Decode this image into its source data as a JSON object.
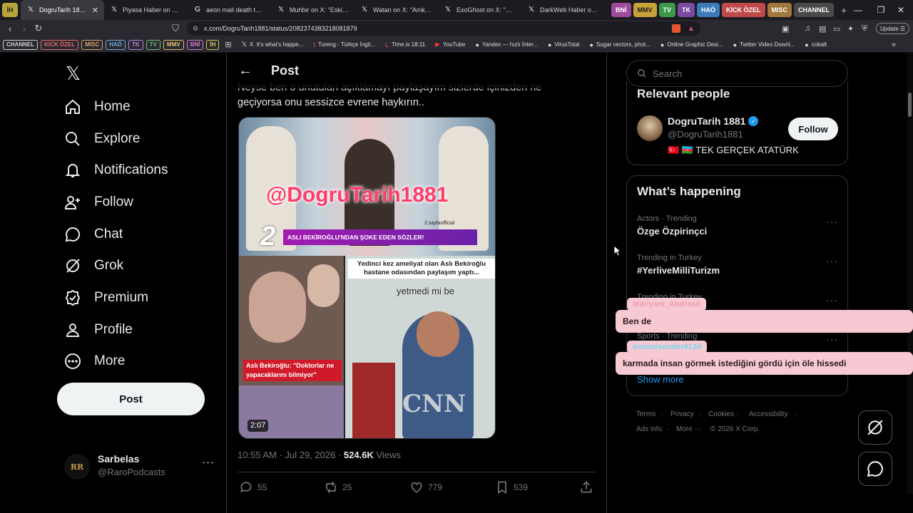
{
  "browser": {
    "pinned_left": [
      {
        "label": "İH",
        "color": "#b8a53a"
      }
    ],
    "tabs": [
      {
        "title": "DogruTarih 1881 on X",
        "active": true
      },
      {
        "title": "Piyasa Haber on X: \"Jap..."
      },
      {
        "title": "aeon mall death toll - G"
      },
      {
        "title": "Muhbir on X: \"Eski g..."
      },
      {
        "title": "Watan on X: \"Amk bu ü..."
      },
      {
        "title": "ExoGhost on X: \"The m..."
      },
      {
        "title": "DarkWeb Haber on X: \"..."
      }
    ],
    "groups": [
      {
        "label": "BNİ",
        "color": "#a04a9b"
      },
      {
        "label": "MMV",
        "color": "#c8a23a"
      },
      {
        "label": "TV",
        "color": "#3c9a4a"
      },
      {
        "label": "TK",
        "color": "#7a4aa0"
      },
      {
        "label": "HAÖ",
        "color": "#3a7ab8"
      },
      {
        "label": "KİCK ÖZEL",
        "color": "#c04a4a"
      },
      {
        "label": "MISC",
        "color": "#a0783a"
      },
      {
        "label": "CHANNEL",
        "color": "#4a4a4a"
      }
    ],
    "url": "x.com/DogruTarih1881/status/2082374383218081879",
    "update_label": "Update",
    "bookmark_pills": [
      {
        "label": "CHANNEL",
        "color": "#cfcfcf"
      },
      {
        "label": "KİCK ÖZEL",
        "color": "#e06a6a"
      },
      {
        "label": "MISC",
        "color": "#d8a66a"
      },
      {
        "label": "HAÖ",
        "color": "#6aaee0"
      },
      {
        "label": "TK",
        "color": "#b68ae0"
      },
      {
        "label": "TV",
        "color": "#6ac07a"
      },
      {
        "label": "MMV",
        "color": "#e0c06a"
      },
      {
        "label": "BNİ",
        "color": "#d87ad0"
      },
      {
        "label": "İH",
        "color": "#d8c85a"
      }
    ],
    "bookmarks": [
      {
        "icon": "𝕏",
        "label": "X. It's what's happe..."
      },
      {
        "icon": "t",
        "label": "Tureng - Türkçe İngil..."
      },
      {
        "icon": "L",
        "label": "Time.is 18:11"
      },
      {
        "icon": "▶",
        "label": "YouTube"
      },
      {
        "icon": "●",
        "label": "Yandex — hızlı İnter..."
      },
      {
        "icon": "●",
        "label": "VirusTotal"
      },
      {
        "icon": "●",
        "label": "Sugar vectors, phot..."
      },
      {
        "icon": "●",
        "label": "Online Graphic Desi..."
      },
      {
        "icon": "●",
        "label": "Twitter Video Downl..."
      },
      {
        "icon": "●",
        "label": "cobalt"
      }
    ]
  },
  "nav": {
    "items": [
      "Home",
      "Explore",
      "Notifications",
      "Follow",
      "Chat",
      "Grok",
      "Premium",
      "Profile",
      "More"
    ],
    "post_label": "Post",
    "account": {
      "name": "Sarbelas",
      "handle": "@RaroPodcasts"
    }
  },
  "post": {
    "header": "Post",
    "text_line1": "Neyse ben o unutulan açıklamayı paylaşayım sizlerde içinizden ne",
    "text_line2": "geçiyorsa onu sessizce evrene haykırın..",
    "image": {
      "watermark": "@DogruTarih1881",
      "banner": "ASLI BEKİROĞLU'NDAN ŞOKE EDEN SÖZLER!",
      "badge": "2.sayfaofficial",
      "caption_top": "Yedinci kez ameliyat olan Aslı Bekiroğlu hastane odasından paylaşım yaptı...",
      "caption_mid": "yetmedi mi be",
      "caption_quote": "Aslı Bekiroğlu: \"Doktorlar ne yapacaklarını bilmiyor\"",
      "duration": "2:07",
      "logo": "CNN"
    },
    "time": "10:55 AM · Jul 29, 2026",
    "views_count": "524.6K",
    "views_label": "Views",
    "stats": {
      "replies": "55",
      "reposts": "25",
      "likes": "779",
      "bookmarks": "539"
    }
  },
  "right": {
    "search_placeholder": "Search",
    "relevant_title": "Relevant people",
    "person": {
      "name": "DogruTarih 1881",
      "handle": "@DogruTarih1881",
      "bio": "🇹🇷 🇦🇿 TEK GERÇEK ATATÜRK",
      "follow_label": "Follow"
    },
    "happening_title": "What’s happening",
    "trends": [
      {
        "meta": "Actors · Trending",
        "name": "Özge Özpirinçci"
      },
      {
        "meta": "Trending in Turkey",
        "name": "#YerliveMilliTurizm"
      },
      {
        "meta": "Trending in Turkey",
        "name": ""
      },
      {
        "meta": "Sports · Trending",
        "name": ""
      }
    ],
    "show_more": "Show more",
    "footer": [
      "Terms",
      "Privacy",
      "Cookies",
      "Accessibility",
      "Ads info",
      "More ···",
      "© 2026 X Corp."
    ]
  },
  "chat_overlay": [
    {
      "user": "Mariyam_Abdrasil",
      "message": "Ben de"
    },
    {
      "user": "emeralsender6134",
      "message": "karmada insan görmek istediğini gördü için öle hissedi"
    }
  ]
}
